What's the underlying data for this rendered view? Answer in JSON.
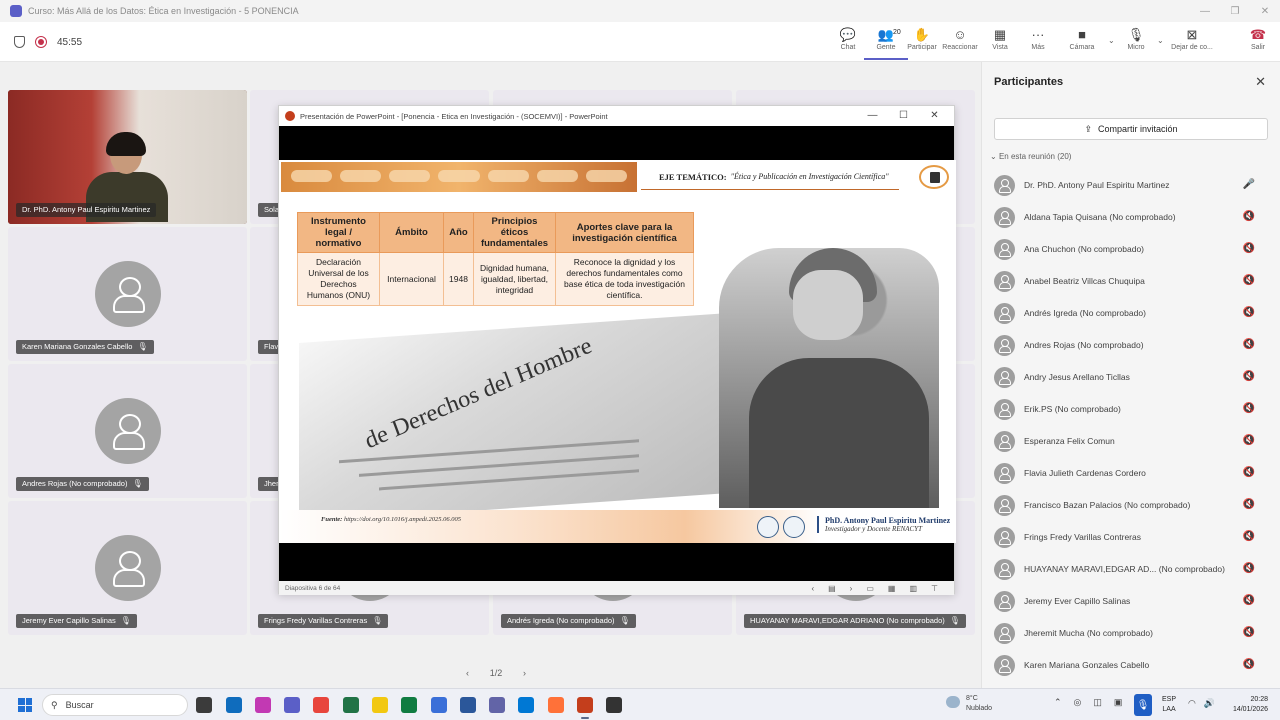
{
  "window": {
    "title": "Curso: Más Allá de los Datos: Ética en Investigación - 5 PONENCIA"
  },
  "meeting": {
    "timer": "45:55",
    "toolbar": [
      {
        "label": "Chat",
        "icon": "chat-icon",
        "glyph": "💬"
      },
      {
        "label": "Gente",
        "icon": "people-icon",
        "glyph": "👥",
        "count": "20"
      },
      {
        "label": "Participar",
        "icon": "raise-hand-icon",
        "glyph": "✋"
      },
      {
        "label": "Reaccionar",
        "icon": "emoji-icon",
        "glyph": "☺"
      },
      {
        "label": "Vista",
        "icon": "view-icon",
        "glyph": "▦"
      },
      {
        "label": "Más",
        "icon": "more-icon",
        "glyph": "···"
      },
      {
        "label": "Cámara",
        "icon": "camera-icon",
        "glyph": "■"
      },
      {
        "label": "Micro",
        "icon": "mic-icon",
        "glyph": "🎙"
      },
      {
        "label": "Dejar de co...",
        "icon": "stop-share-icon",
        "glyph": "⊠"
      },
      {
        "label": "Salir",
        "icon": "leave-icon",
        "glyph": "☎"
      }
    ]
  },
  "tiles": [
    {
      "name": "Dr. PhD. Antony Paul Espiritu Martinez"
    },
    {
      "name": "Karen Mariana Gonzales Cabello"
    },
    {
      "name": "Andres Rojas (No comprobado)"
    },
    {
      "name": "Jeremy Ever Capillo Salinas"
    },
    {
      "name": "Solan"
    },
    {
      "name": "Flavia"
    },
    {
      "name": "Jhere"
    },
    {
      "name": "Frings Fredy Varillas Contreras"
    },
    {
      "name": "Andrés Igreda (No comprobado)"
    },
    {
      "name": "HUAYANAY MARAVI,EDGAR ADRIANO (No comprobado)"
    }
  ],
  "pager": {
    "text": "1/2"
  },
  "ppt": {
    "title": "Presentación de PowerPoint - [Ponencia - Etica en Investigación - (SOCEMVI)] - PowerPoint",
    "status": "Diapositiva 6 de 64",
    "slide": {
      "eje_label": "EJE TEMÁTICO:",
      "eje_text": "\"Ética y Publicación en Investigación Científica\"",
      "table": {
        "headers": [
          "Instrumento legal / normativo",
          "Ámbito",
          "Año",
          "Principios éticos fundamentales",
          "Aportes clave para la investigación científica"
        ],
        "row": [
          "Declaración Universal de los Derechos Humanos (ONU)",
          "Internacional",
          "1948",
          "Dignidad humana, igualdad, libertad, integridad",
          "Reconoce la dignidad y los derechos fundamentales como base ética de toda investigación científica."
        ]
      },
      "photo_headline": "de Derechos del Hombre",
      "fuente_label": "Fuente:",
      "fuente_url": "https://doi.org/10.1016/j.anpedi.2025.06.005",
      "author": "PhD. Antony Paul Espiritu Martinez",
      "author_role": "Investigador y Docente RENACYT"
    }
  },
  "participants": {
    "title": "Participantes",
    "share_label": "Compartir invitación",
    "section": "En esta reunión (20)",
    "list": [
      {
        "name": "Dr. PhD. Antony Paul Espiritu Martinez",
        "mic": "🎤"
      },
      {
        "name": "Aldana Tapia Quisana (No comprobado)",
        "mic": "🔇"
      },
      {
        "name": "Ana Chuchon (No comprobado)",
        "mic": "🔇"
      },
      {
        "name": "Anabel Beatriz Villcas Chuquipa",
        "mic": "🔇"
      },
      {
        "name": "Andrés Igreda (No comprobado)",
        "mic": "🔇"
      },
      {
        "name": "Andres Rojas (No comprobado)",
        "mic": "🔇"
      },
      {
        "name": "Andry Jesus Arellano Ticllas",
        "mic": "🔇"
      },
      {
        "name": "Erik.PS (No comprobado)",
        "mic": "🔇"
      },
      {
        "name": "Esperanza Felix Comun",
        "mic": "🔇"
      },
      {
        "name": "Flavia Julieth Cardenas Cordero",
        "mic": "🔇"
      },
      {
        "name": "Francisco Bazan Palacios (No comprobado)",
        "mic": "🔇"
      },
      {
        "name": "Frings Fredy Varillas Contreras",
        "mic": "🔇"
      },
      {
        "name": "HUAYANAY MARAVI,EDGAR AD...   (No comprobado)",
        "mic": "🔇"
      },
      {
        "name": "Jeremy Ever Capillo Salinas",
        "mic": "🔇"
      },
      {
        "name": "Jheremit Mucha (No comprobado)",
        "mic": "🔇"
      },
      {
        "name": "Karen Mariana Gonzales Cabello",
        "mic": "🔇"
      }
    ]
  },
  "taskbar": {
    "search_placeholder": "Buscar",
    "weather_temp": "8°C",
    "weather_desc": "Nublado",
    "lang1": "ESP",
    "lang2": "LAA",
    "time": "20:28",
    "date": "14/01/2026",
    "app_colors": [
      "#3b3b3b",
      "#0f6cbd",
      "#c239b3",
      "#5b5fc7",
      "#e8453c",
      "#217346",
      "#f2c811",
      "#107c41",
      "#3a6fd8",
      "#2b579a",
      "#6264a7",
      "#0078d4",
      "#ff7139",
      "#c43e1c",
      "#333333"
    ]
  }
}
